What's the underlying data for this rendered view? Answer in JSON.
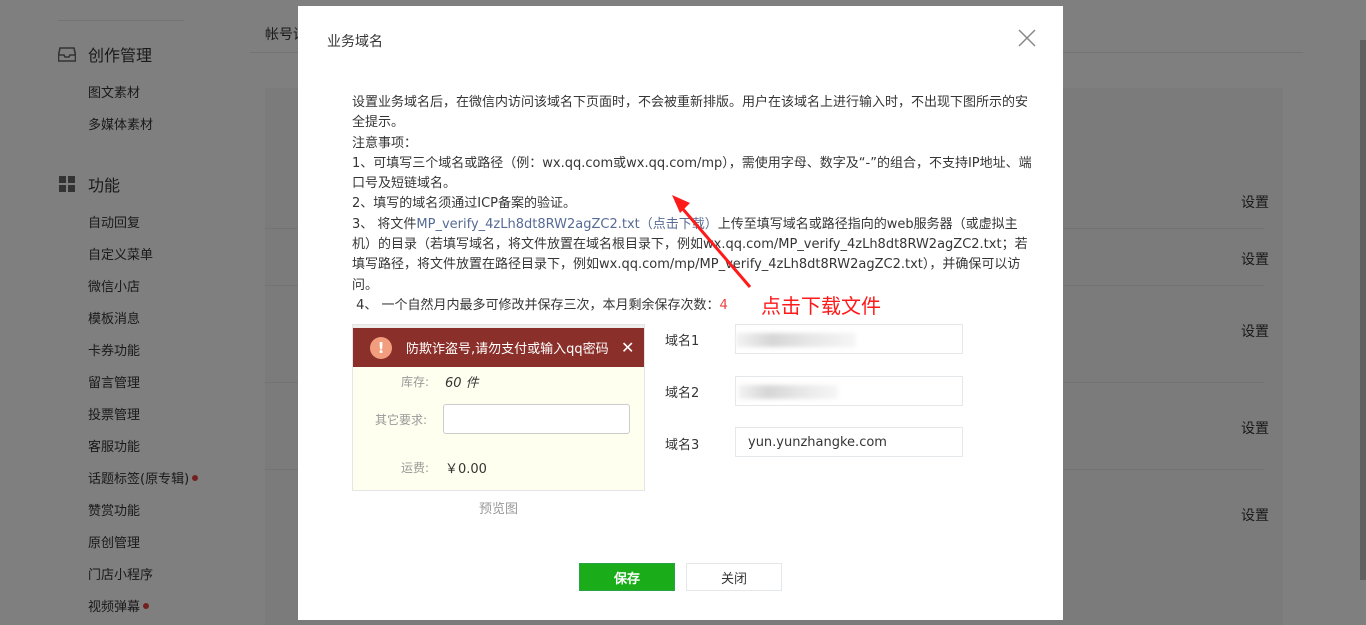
{
  "sidebar": {
    "groups": [
      {
        "title": "创作管理",
        "icon": "inbox-icon",
        "items": [
          {
            "label": "图文素材"
          },
          {
            "label": "多媒体素材"
          }
        ]
      },
      {
        "title": "功能",
        "icon": "grid-icon",
        "items": [
          {
            "label": "自动回复"
          },
          {
            "label": "自定义菜单"
          },
          {
            "label": "微信小店"
          },
          {
            "label": "模板消息"
          },
          {
            "label": "卡券功能"
          },
          {
            "label": "留言管理"
          },
          {
            "label": "投票管理"
          },
          {
            "label": "客服功能"
          },
          {
            "label": "话题标签(原专辑)",
            "badge": true
          },
          {
            "label": "赞赏功能"
          },
          {
            "label": "原创管理"
          },
          {
            "label": "门店小程序"
          },
          {
            "label": "视频弹幕",
            "badge": true
          }
        ]
      }
    ]
  },
  "background": {
    "tab_label": "帐号设",
    "settings_label": "设置"
  },
  "dialog": {
    "title": "业务域名",
    "desc_line1": "设置业务域名后，在微信内访问该域名下页面时，不会被重新排版。用户在该域名上进行输入时，不出现下图所示的安全提示。",
    "notice_heading": "注意事项：",
    "rule1": "1、可填写三个域名或路径（例：wx.qq.com或wx.qq.com/mp），需使用字母、数字及“-”的组合，不支持IP地址、端口号及短链域名。",
    "rule2": "2、填写的域名须通过ICP备案的验证。",
    "rule3_prefix": "3、 将文件",
    "rule3_file": "MP_verify_4zLh8dt8RW2agZC2.txt（点击下载）",
    "rule3_suffix": "上传至填写域名或路径指向的web服务器（或虚拟主机）的目录（若填写域名，将文件放置在域名根目录下，例如wx.qq.com/MP_verify_4zLh8dt8RW2agZC2.txt；若填写路径，将文件放置在路径目录下，例如wx.qq.com/mp/MP_verify_4zLh8dt8RW2agZC2.txt），并确保可以访问。",
    "rule4_prefix": "4、 一个自然月内最多可修改并保存三次，本月剩余保存次数：",
    "rule4_count": "4",
    "annotation": "点击下载文件",
    "preview": {
      "banner_text": "防欺诈盗号,请勿支付或输入qq密码",
      "close_glyph": "✕",
      "warn_glyph": "!",
      "stock_label": "库存:",
      "stock_value": "60 件",
      "other_label": "其它要求:",
      "fee_label": "运费:",
      "fee_value": "￥0.00",
      "caption": "预览图"
    },
    "domains": [
      {
        "label": "域名1",
        "value": ""
      },
      {
        "label": "域名2",
        "value": ""
      },
      {
        "label": "域名3",
        "value": "yun.yunzhangke.com"
      }
    ],
    "save_label": "保存",
    "close_label": "关闭"
  },
  "colors": {
    "accent_green": "#1aad19",
    "link_blue": "#576b95",
    "warning_red": "#e64340",
    "annotation_red": "#ff1a1a",
    "banner_red": "#8b2f2a"
  }
}
